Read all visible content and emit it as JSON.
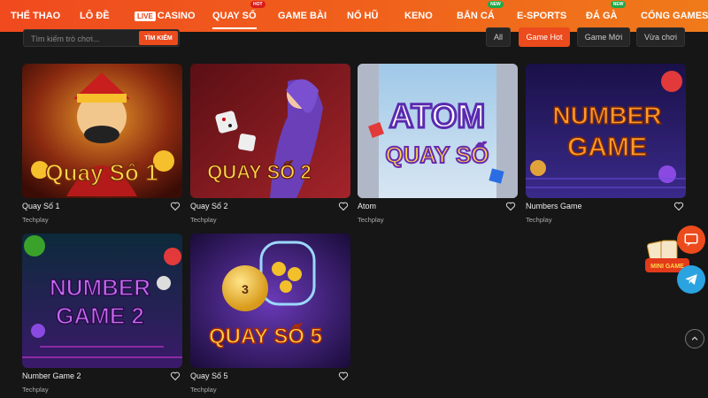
{
  "nav": {
    "items": [
      {
        "label": "THỂ THAO"
      },
      {
        "label": "LÔ ĐỀ"
      },
      {
        "live": "LIVE",
        "label": "CASINO"
      },
      {
        "label": "QUAY SỐ",
        "badge": "HOT"
      },
      {
        "label": "GAME BÀI"
      },
      {
        "label": "NỔ HŨ"
      },
      {
        "label": "KENO"
      },
      {
        "label": "BẮN CÁ",
        "badge": "NEW"
      },
      {
        "label": "E-SPORTS"
      },
      {
        "label": "ĐÁ GÀ",
        "badge": "NEW"
      },
      {
        "label": "CỔNG GAMES"
      }
    ]
  },
  "search": {
    "placeholder": "Tìm kiếm trò chơi...",
    "button_label": "TÌM KIẾM"
  },
  "filters": [
    {
      "label": "All"
    },
    {
      "label": "Game Hot"
    },
    {
      "label": "Game Mới"
    },
    {
      "label": "Vừa chơi"
    }
  ],
  "games": [
    {
      "title": "Quay Số 1",
      "provider": "Techplay",
      "art_text": "Quay Số 1"
    },
    {
      "title": "Quay Số 2",
      "provider": "Techplay",
      "art_text": "QUAY SỐ 2"
    },
    {
      "title": "Atom",
      "provider": "Techplay",
      "art_text_1": "ATOM",
      "art_text_2": "QUAY SỐ"
    },
    {
      "title": "Numbers Game",
      "provider": "Techplay",
      "art_text_1": "NUMBER",
      "art_text_2": "GAME"
    },
    {
      "title": "Number Game 2",
      "provider": "Techplay",
      "art_text_1": "NUMBER",
      "art_text_2": "GAME 2"
    },
    {
      "title": "Quay Số 5",
      "provider": "Techplay",
      "art_text": "QUAY SỐ 5"
    }
  ],
  "floating": {
    "mini_game_label": "MINI GAME"
  },
  "colors": {
    "brand_orange": "#ec4b1d",
    "background": "#161616",
    "badge_hot": "#d81b1b",
    "badge_new": "#1fa84a",
    "telegram": "#2aa3e0"
  }
}
